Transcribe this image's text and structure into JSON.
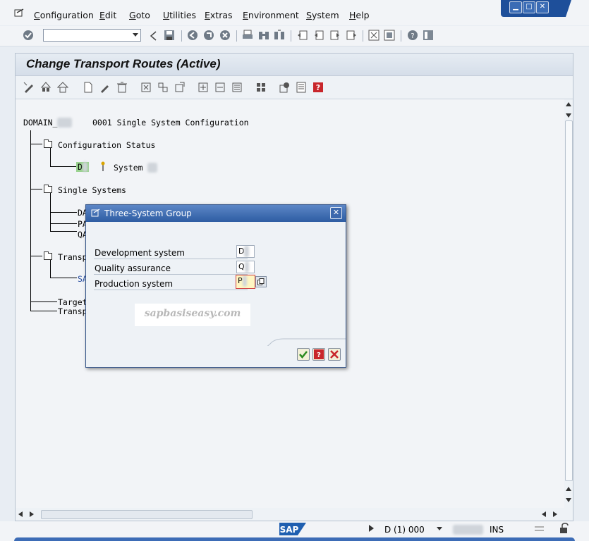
{
  "menu": {
    "items": [
      "Configuration",
      "Edit",
      "Goto",
      "Utilities",
      "Extras",
      "Environment",
      "System",
      "Help"
    ]
  },
  "command_field": {
    "value": ""
  },
  "screen": {
    "title": "Change Transport Routes (Active)"
  },
  "tree": {
    "domain_label": "DOMAIN_",
    "domain_desc": "0001 Single System Configuration",
    "configuration_status": "Configuration Status",
    "status_system_id": "D",
    "status_system_label": "System",
    "single_systems": "Single Systems",
    "single_system_ids": [
      "DA",
      "PA",
      "QA"
    ],
    "transport_layers_label": "Transp",
    "transport_layer_child": "SA",
    "target_groups_label": "Target",
    "transport_routes_label": "Transp"
  },
  "dialog": {
    "title": "Three-System Group",
    "fields": [
      {
        "label": "Development system",
        "value": "D"
      },
      {
        "label": "Quality assurance",
        "value": "Q"
      },
      {
        "label": "Production system",
        "value": "P"
      }
    ],
    "watermark": "sapbasiseasy.com"
  },
  "status": {
    "system": "D  (1) 000",
    "mode": "INS",
    "logo": "SAP"
  },
  "colors": {
    "title_blue": "#2e5da3",
    "status_green": "#9ad28f",
    "focus_yellow": "#fff6c2"
  }
}
